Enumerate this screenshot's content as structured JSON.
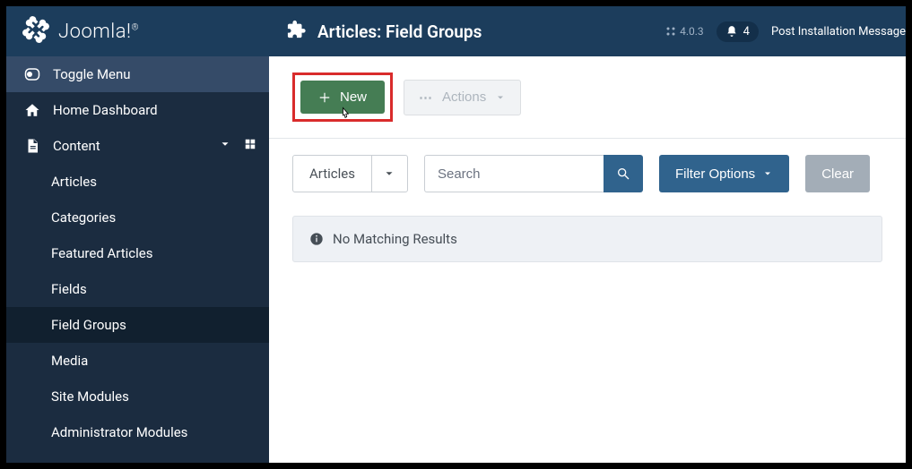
{
  "brand": {
    "name": "Joomla!"
  },
  "header": {
    "title": "Articles: Field Groups",
    "version": "4.0.3",
    "notif_count": "4",
    "post_install": "Post Installation Message"
  },
  "sidebar": {
    "toggle": "Toggle Menu",
    "home": "Home Dashboard",
    "content": "Content",
    "items": [
      {
        "label": "Articles",
        "has_plus": true
      },
      {
        "label": "Categories",
        "has_plus": true
      },
      {
        "label": "Featured Articles",
        "has_plus": false
      },
      {
        "label": "Fields",
        "has_plus": false
      },
      {
        "label": "Field Groups",
        "has_plus": false,
        "active": true
      },
      {
        "label": "Media",
        "has_plus": false
      },
      {
        "label": "Site Modules",
        "has_plus": true
      },
      {
        "label": "Administrator Modules",
        "has_plus": true
      }
    ]
  },
  "toolbar": {
    "new_label": "New",
    "actions_label": "Actions"
  },
  "filters": {
    "context": "Articles",
    "search_placeholder": "Search",
    "filter_options": "Filter Options",
    "clear": "Clear"
  },
  "results": {
    "empty": "No Matching Results"
  }
}
